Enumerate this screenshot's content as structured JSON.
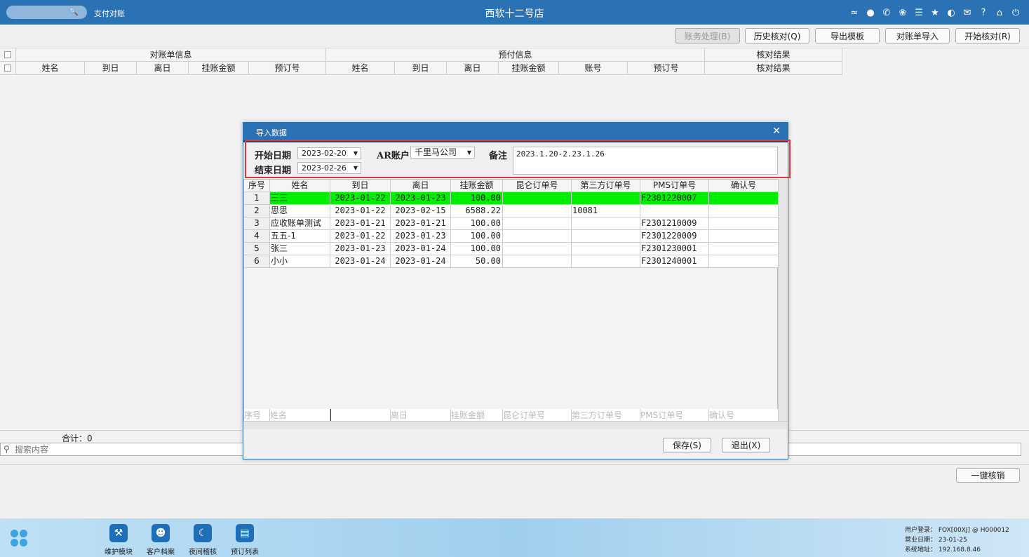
{
  "topbar": {
    "module_title": "支付对账",
    "store_name": "西软十二号店",
    "icons": [
      "wifi-icon",
      "message-icon",
      "phone-icon",
      "palette-icon",
      "menu-icon",
      "star-icon",
      "theme-icon",
      "mail-icon",
      "help-icon",
      "home-icon",
      "power-icon"
    ]
  },
  "toolbar": {
    "finance_btn": "账务处理(B)",
    "history_btn": "历史核对(Q)",
    "export_btn": "导出模板",
    "import_btn": "对账单导入",
    "start_btn": "开始核对(R)"
  },
  "grid": {
    "group_headers": [
      "对账单信息",
      "预付信息",
      "核对结果"
    ],
    "columns": [
      "姓名",
      "到日",
      "离日",
      "挂账金额",
      "预订号",
      "姓名",
      "到日",
      "离日",
      "挂账金额",
      "账号",
      "预订号",
      "核对结果"
    ]
  },
  "footer": {
    "total": "合计：0",
    "search_placeholder": "搜索内容",
    "writeoff_btn": "一键核销"
  },
  "taskbar": {
    "items": [
      "维护模块",
      "客户档案",
      "夜间稽核",
      "预订列表"
    ],
    "sys_user": "用户登录： FOX[00XJ] @ H000012",
    "sys_date": "营业日期： 23-01-25",
    "sys_addr": "系统地址： 192.168.8.46"
  },
  "modal": {
    "title": "导入数据",
    "start_label": "开始日期",
    "start_date": "2023-02-20",
    "end_label": "结束日期",
    "end_date": "2023-02-26",
    "ar_label": "AR账户",
    "ar_value": "千里马公司",
    "remark_label": "备注",
    "remark_value": "2023.1.20-2.23.1.26",
    "columns": [
      "序号",
      "姓名",
      "到日",
      "离日",
      "挂账金额",
      "昆仑订单号",
      "第三方订单号",
      "PMS订单号",
      "确认号"
    ],
    "rows": [
      [
        "1",
        "三三",
        "2023-01-22",
        "2023-01-23",
        "100.00",
        "",
        "",
        "F2301220007",
        ""
      ],
      [
        "2",
        "思思",
        "2023-01-22",
        "2023-02-15",
        "6588.22",
        "",
        "10081",
        "",
        ""
      ],
      [
        "3",
        "应收账单测试",
        "2023-01-21",
        "2023-01-21",
        "100.00",
        "",
        "",
        "F2301210009",
        ""
      ],
      [
        "4",
        "五五-1",
        "2023-01-22",
        "2023-01-23",
        "100.00",
        "",
        "",
        "F2301220009",
        ""
      ],
      [
        "5",
        "张三",
        "2023-01-23",
        "2023-01-24",
        "100.00",
        "",
        "",
        "F2301230001",
        ""
      ],
      [
        "6",
        "小小",
        "2023-01-24",
        "2023-01-24",
        "50.00",
        "",
        "",
        "F2301240001",
        ""
      ]
    ],
    "new_row_placeholders": [
      "序号",
      "姓名",
      "",
      "离日",
      "挂账金额",
      "昆仑订单号",
      "第三方订单号",
      "PMS订单号",
      "确认号"
    ],
    "save_btn": "保存(S)",
    "exit_btn": "退出(X)"
  }
}
